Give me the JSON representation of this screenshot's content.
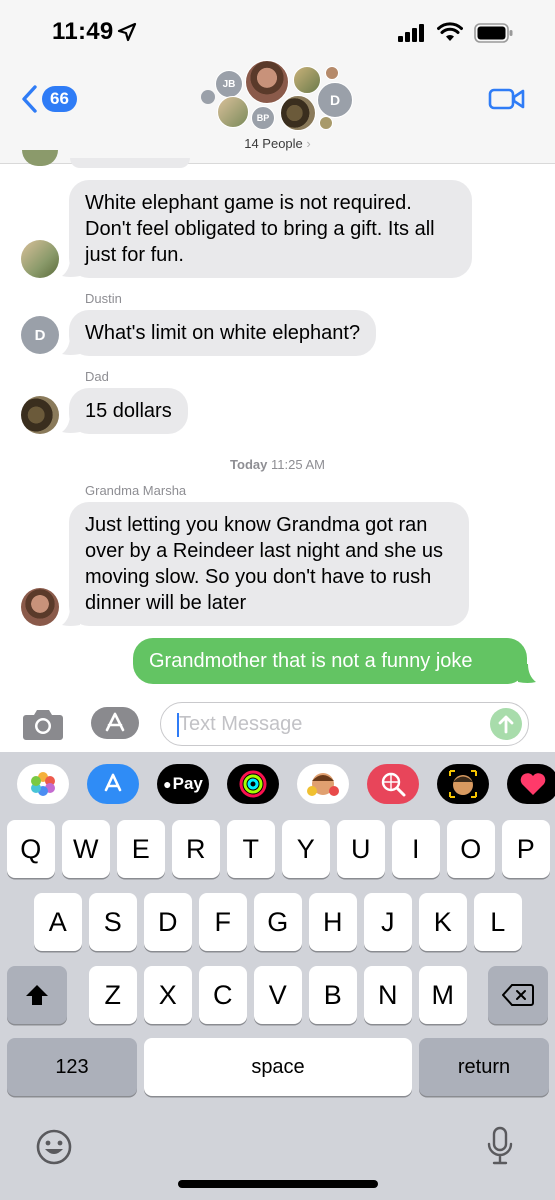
{
  "status_bar": {
    "time": "11:49"
  },
  "header": {
    "back_badge": "66",
    "people_label": "14 People",
    "people_chevron": "›",
    "avatars": [
      {
        "initials": "JB"
      },
      {
        "initials": "BP"
      },
      {
        "initials": "D"
      }
    ]
  },
  "messages": [
    {
      "type": "incoming",
      "sender": "",
      "text": "White elephant game is not required. Don't feel obligated to bring a gift. Its all just for fun."
    },
    {
      "type": "incoming",
      "sender": "Dustin",
      "avatar_initial": "D",
      "text": "What's limit on white elephant?"
    },
    {
      "type": "incoming",
      "sender": "Dad",
      "text": "15 dollars"
    },
    {
      "type": "incoming",
      "sender": "Grandma Marsha",
      "text": "Just letting you know Grandma got ran over by a Reindeer last night  and she  us moving slow.  So you don't have to rush dinner will be later"
    },
    {
      "type": "outgoing",
      "text": "Grandmother that is not a funny joke"
    }
  ],
  "timestamp": {
    "day": "Today",
    "time": "11:25 AM"
  },
  "compose": {
    "placeholder": "Text Message"
  },
  "keyboard": {
    "row1": [
      "Q",
      "W",
      "E",
      "R",
      "T",
      "Y",
      "U",
      "I",
      "O",
      "P"
    ],
    "row2": [
      "A",
      "S",
      "D",
      "F",
      "G",
      "H",
      "J",
      "K",
      "L"
    ],
    "row3": [
      "Z",
      "X",
      "C",
      "V",
      "B",
      "N",
      "M"
    ],
    "numbers_label": "123",
    "space_label": "space",
    "return_label": "return",
    "apple_pay_label": "Pay"
  },
  "colors": {
    "accent": "#2f7cf6",
    "outgoing_bubble": "#63c463",
    "incoming_bubble": "#e9e9eb"
  },
  "icons": [
    "back-chevron-icon",
    "video-call-icon",
    "camera-icon",
    "app-store-icon",
    "send-arrow-icon",
    "photos-icon",
    "apple-pay-icon",
    "activity-icon",
    "memoji-icon",
    "search-globe-icon",
    "animoji-icon",
    "heart-icon",
    "shift-icon",
    "delete-icon",
    "emoji-icon",
    "mic-icon"
  ]
}
